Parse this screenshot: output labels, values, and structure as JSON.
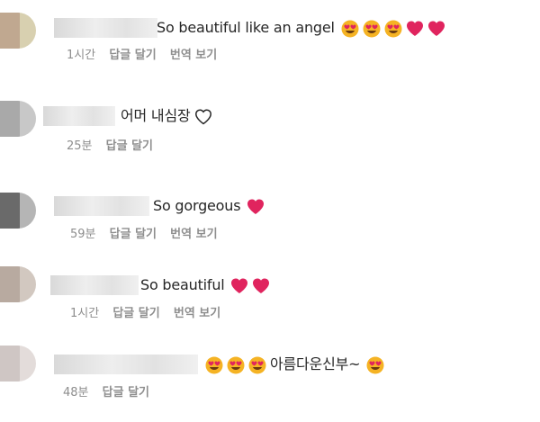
{
  "comments": [
    {
      "text": "So beautiful like an angel",
      "emoji": [
        "heart-eyes-emoji",
        "heart-eyes-emoji",
        "heart-eyes-emoji",
        "red-heart-emoji",
        "red-heart-emoji"
      ],
      "time": "1시간",
      "reply": "답글 달기",
      "translate": "번역 보기"
    },
    {
      "text": "어머 내심장",
      "emoji": [
        "white-heart-outline-emoji"
      ],
      "time": "25분",
      "reply": "답글 달기"
    },
    {
      "text": "So gorgeous",
      "emoji": [
        "red-heart-emoji"
      ],
      "time": "59분",
      "reply": "답글 달기",
      "translate": "번역 보기"
    },
    {
      "text": "So beautiful",
      "emoji": [
        "red-heart-emoji",
        "red-heart-emoji"
      ],
      "time": "1시간",
      "reply": "답글 달기",
      "translate": "번역 보기"
    },
    {
      "text_prefix_emoji": [
        "heart-eyes-emoji",
        "heart-eyes-emoji",
        "heart-eyes-emoji"
      ],
      "text": "아름다운신부~",
      "emoji": [
        "heart-eyes-emoji"
      ],
      "time": "48분",
      "reply": "답글 달기"
    }
  ],
  "colors": {
    "meta": "#8e8e8e",
    "text": "#262626",
    "heart": "#e0245e",
    "emoji_face": "#f5b324"
  }
}
